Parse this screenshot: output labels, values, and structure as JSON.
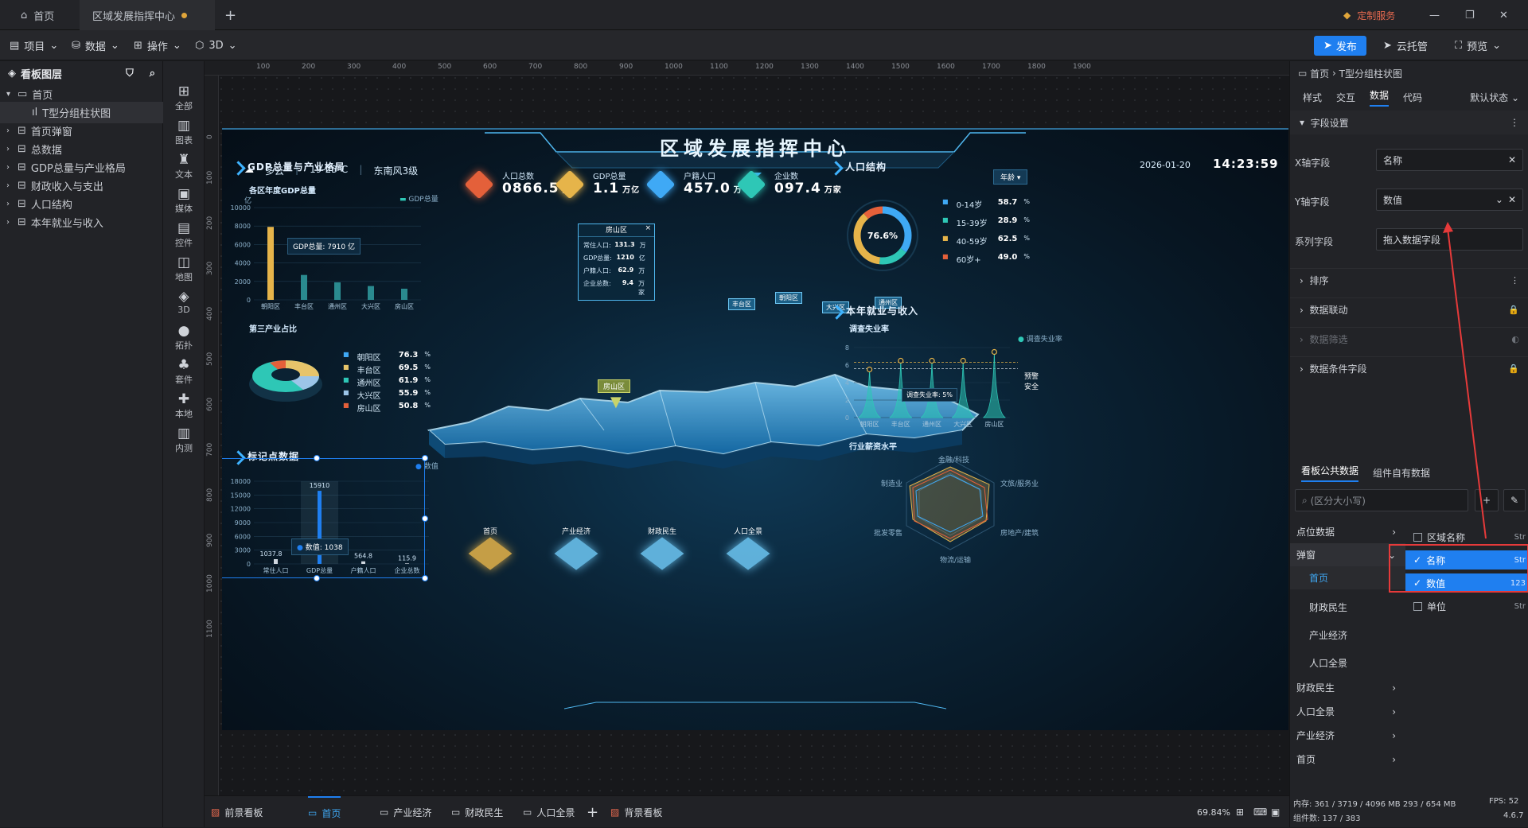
{
  "tabs": [
    {
      "label": "首页"
    },
    {
      "label": "区域发展指挥中心",
      "modified": true
    }
  ],
  "topbar": {
    "custom_service": "定制服务",
    "new_tab": "+",
    "minimize": "—",
    "restore": "❐",
    "close": "✕"
  },
  "toolbar": {
    "project": "项目",
    "data": "数据",
    "operate": "操作",
    "three_d": "3D",
    "publish": "发布",
    "cloud_host": "云托管",
    "preview": "预览"
  },
  "layers": {
    "header": "看板图层",
    "items": [
      {
        "label": "首页",
        "level": 0,
        "expanded": true
      },
      {
        "label": "T型分组柱状图",
        "level": 1,
        "selected": true
      },
      {
        "label": "首页弹窗",
        "level": 0
      },
      {
        "label": "总数据",
        "level": 0
      },
      {
        "label": "GDP总量与产业格局",
        "level": 0
      },
      {
        "label": "财政收入与支出",
        "level": 0
      },
      {
        "label": "人口结构",
        "level": 0
      },
      {
        "label": "本年就业与收入",
        "level": 0
      }
    ]
  },
  "iconbar": [
    "全部",
    "图表",
    "文本",
    "媒体",
    "控件",
    "地图",
    "3D",
    "拓扑",
    "套件",
    "本地",
    "内测"
  ],
  "ruler": {
    "h": [
      "100",
      "200",
      "300",
      "400",
      "500",
      "600",
      "700",
      "800",
      "900",
      "1000",
      "1100",
      "1200",
      "1300",
      "1400",
      "1500",
      "1600",
      "1700",
      "1800",
      "1900"
    ],
    "v": [
      "0",
      "100",
      "200",
      "300",
      "400",
      "500",
      "600",
      "700",
      "800",
      "900",
      "1000",
      "1100"
    ]
  },
  "dashboard": {
    "title": "区域发展指挥中心",
    "weather": "多云",
    "temp": "19-23℃",
    "wind": "东南风3级",
    "date": "2026-01-20",
    "time": "14:23:59",
    "kpis": [
      {
        "label": "人口总数",
        "value": "0866.5",
        "unit": "万",
        "color": "#e4603a"
      },
      {
        "label": "GDP总量",
        "value": "1.1",
        "unit": "万亿",
        "color": "#e6b44a"
      },
      {
        "label": "户籍人口",
        "value": "457.0",
        "unit": "万",
        "color": "#3fa9f5"
      },
      {
        "label": "企业数",
        "value": "097.4",
        "unit": "万家",
        "color": "#2ec7b6"
      }
    ],
    "gdp_panel": {
      "title": "GDP总量与产业格局",
      "sub": "各区年度GDP总量",
      "unit": "亿",
      "legend": "GDP总量",
      "tooltip": "GDP总量: 7910 亿",
      "industry_title": "第三产业占比",
      "industry": [
        {
          "name": "朝阳区",
          "value": "76.3",
          "unit": "%",
          "color": "#3fa9f5"
        },
        {
          "name": "丰台区",
          "value": "69.5",
          "unit": "%",
          "color": "#e6c46a"
        },
        {
          "name": "通州区",
          "value": "61.9",
          "unit": "%",
          "color": "#2ec7b6"
        },
        {
          "name": "大兴区",
          "value": "55.9",
          "unit": "%",
          "color": "#9cc5e8"
        },
        {
          "name": "房山区",
          "value": "50.8",
          "unit": "%",
          "color": "#e4603a"
        }
      ]
    },
    "marker_panel": {
      "title": "标记点数据",
      "legend": "数值",
      "tooltip_label": "数值:",
      "tooltip_value": "1038"
    },
    "popup": {
      "title": "房山区",
      "close": "×",
      "rows": [
        {
          "label": "常住人口:",
          "value": "131.3",
          "unit": "万"
        },
        {
          "label": "GDP总量:",
          "value": "1210",
          "unit": "亿"
        },
        {
          "label": "户籍人口:",
          "value": "62.9",
          "unit": "万"
        },
        {
          "label": "企业总数:",
          "value": "9.4",
          "unit": "万家"
        }
      ]
    },
    "map_labels": [
      "房山区",
      "丰台区",
      "朝阳区",
      "大兴区",
      "通州区"
    ],
    "bottom_nav": [
      "首页",
      "产业经济",
      "财政民生",
      "人口全景"
    ],
    "population_panel": {
      "title": "人口结构",
      "dropdown": "年龄",
      "center": "76.6%",
      "rows": [
        {
          "name": "0-14岁",
          "value": "58.7",
          "unit": "%",
          "color": "#3fa9f5"
        },
        {
          "name": "15-39岁",
          "value": "28.9",
          "unit": "%",
          "color": "#2ec7b6"
        },
        {
          "name": "40-59岁",
          "value": "62.5",
          "unit": "%",
          "color": "#e6b44a"
        },
        {
          "name": "60岁+",
          "value": "49.0",
          "unit": "%",
          "color": "#e4603a"
        }
      ]
    },
    "employment_panel": {
      "title": "本年就业与收入",
      "sub": "调查失业率",
      "legend": "调查失业率",
      "tooltip": "调查失业率: 5%",
      "ref_labels": [
        "预警",
        "安全"
      ],
      "salary_title": "行业薪资水平",
      "radar_axes": [
        "金融/科技",
        "文旅/服务业",
        "房地产/建筑",
        "物流/运输",
        "批发零售",
        "制造业"
      ]
    }
  },
  "chart_data": [
    {
      "type": "bar",
      "title": "各区年度GDP总量",
      "categories": [
        "朝阳区",
        "丰台区",
        "通州区",
        "大兴区",
        "房山区"
      ],
      "series": [
        {
          "name": "GDP总量",
          "values": [
            7910,
            2700,
            1900,
            1500,
            1210
          ]
        }
      ],
      "ylabel": "亿",
      "ylim": [
        0,
        10000
      ],
      "yticks": [
        "0",
        "2000",
        "4000",
        "6000",
        "8000",
        "10000"
      ]
    },
    {
      "type": "bar",
      "title": "标记点数据",
      "categories": [
        "常住人口",
        "GDP总量",
        "户籍人口",
        "企业总数"
      ],
      "series": [
        {
          "name": "数值",
          "values": [
            1037.8,
            15910,
            564.8,
            115.9
          ]
        }
      ],
      "labels": [
        "1037.8",
        "15910",
        "564.8",
        "115.9"
      ],
      "ylim": [
        0,
        18000
      ],
      "yticks": [
        "0",
        "3000",
        "6000",
        "9000",
        "12000",
        "15000",
        "18000"
      ]
    },
    {
      "type": "area",
      "title": "调查失业率",
      "categories": [
        "朝阳区",
        "丰台区",
        "通州区",
        "大兴区",
        "房山区"
      ],
      "series": [
        {
          "name": "调查失业率",
          "values": [
            5.5,
            6.5,
            6.5,
            6.5,
            7.5
          ]
        }
      ],
      "ylim": [
        0,
        8
      ],
      "yticks": [
        "0",
        "2",
        "4",
        "6",
        "8"
      ]
    },
    {
      "type": "pie",
      "title": "人口结构",
      "categories": [
        "0-14岁",
        "15-39岁",
        "40-59岁",
        "60岁+"
      ],
      "values": [
        58.7,
        28.9,
        62.5,
        49.0
      ],
      "center": "76.6%"
    }
  ],
  "right_panel": {
    "breadcrumb": [
      "首页",
      "T型分组柱状图"
    ],
    "tabs": [
      "样式",
      "交互",
      "数据",
      "代码"
    ],
    "active_tab": "数据",
    "state": "默认状态",
    "field_settings": "字段设置",
    "x_field_label": "X轴字段",
    "x_field_value": "名称",
    "y_field_label": "Y轴字段",
    "y_field_value": "数值",
    "series_field_label": "系列字段",
    "series_field_placeholder": "拖入数据字段",
    "sections": [
      "排序",
      "数据联动",
      "数据筛选",
      "数据条件字段"
    ],
    "data_tabs": [
      "看板公共数据",
      "组件自有数据"
    ],
    "search_placeholder": "(区分大小写)",
    "sources": [
      "点位数据",
      "弹窗",
      "首页",
      "财政民生",
      "产业经济",
      "人口全景",
      "财政民生",
      "人口全景",
      "产业经济",
      "首页"
    ],
    "fields": [
      {
        "name": "区域名称",
        "type": "Str",
        "checked": false
      },
      {
        "name": "名称",
        "type": "Str",
        "checked": true
      },
      {
        "name": "数值",
        "type": "123",
        "checked": true
      },
      {
        "name": "单位",
        "type": "Str",
        "checked": false
      }
    ],
    "mem": "内存: 361 / 3719 / 4096 MB 293 / 654 MB",
    "fps": "FPS: 52",
    "components": "组件数: 137 / 383",
    "version": "4.6.7"
  },
  "bottom_tabs": {
    "foreground": "前景看板",
    "pages": [
      "首页",
      "产业经济",
      "财政民生",
      "人口全景"
    ],
    "add": "+",
    "background": "背景看板",
    "zoom": "69.84%"
  },
  "colors": {
    "accent": "#1f7ff0",
    "highlight": "#e63a3a",
    "gold": "#e6b44a",
    "teal": "#2ec7b6"
  }
}
